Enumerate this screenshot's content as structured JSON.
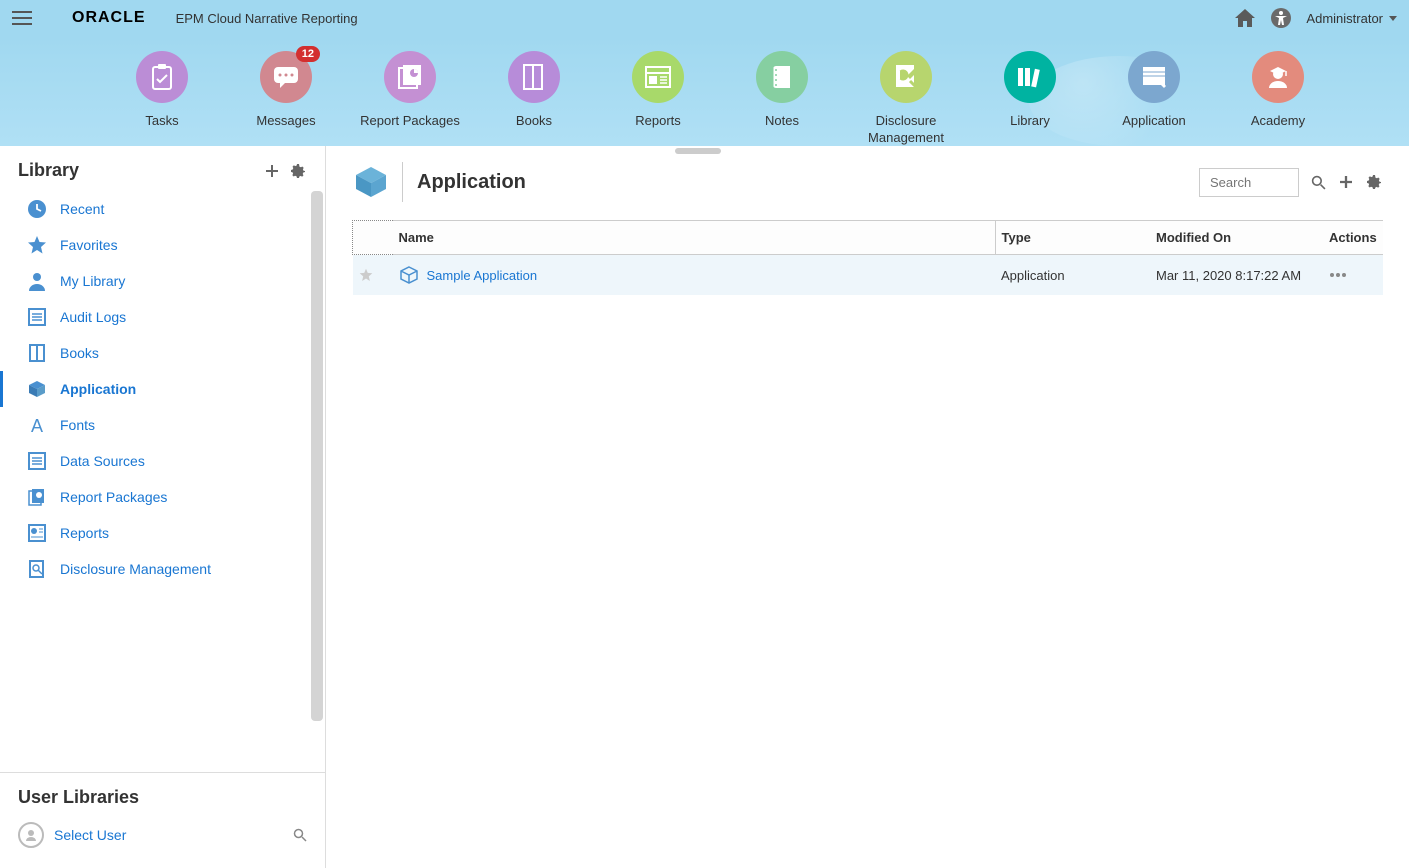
{
  "header": {
    "brand": "ORACLE",
    "product": "EPM Cloud Narrative Reporting",
    "user": "Administrator"
  },
  "nav": [
    {
      "label": "Tasks",
      "color": "#bb8dd6",
      "icon": "clipboard"
    },
    {
      "label": "Messages",
      "color": "#d18890",
      "icon": "chat",
      "badge": "12"
    },
    {
      "label": "Report Packages",
      "color": "#c490d3",
      "icon": "report-pkg"
    },
    {
      "label": "Books",
      "color": "#b78cd9",
      "icon": "book"
    },
    {
      "label": "Reports",
      "color": "#a8d96a",
      "icon": "report"
    },
    {
      "label": "Notes",
      "color": "#86cfa1",
      "icon": "notes"
    },
    {
      "label": "Disclosure\nManagement",
      "color": "#b7d56e",
      "icon": "disclosure"
    },
    {
      "label": "Library",
      "color": "#00b3a1",
      "icon": "library",
      "selected": true
    },
    {
      "label": "Application",
      "color": "#7ca7cf",
      "icon": "application"
    },
    {
      "label": "Academy",
      "color": "#e38b7d",
      "icon": "academy"
    }
  ],
  "sidebar": {
    "title": "Library",
    "items": [
      {
        "label": "Recent",
        "icon": "clock"
      },
      {
        "label": "Favorites",
        "icon": "star"
      },
      {
        "label": "My Library",
        "icon": "person"
      },
      {
        "label": "Audit Logs",
        "icon": "lines"
      },
      {
        "label": "Books",
        "icon": "book-small"
      },
      {
        "label": "Application",
        "icon": "cube",
        "selected": true
      },
      {
        "label": "Fonts",
        "icon": "font"
      },
      {
        "label": "Data Sources",
        "icon": "lines"
      },
      {
        "label": "Report Packages",
        "icon": "report-pkg-small"
      },
      {
        "label": "Reports",
        "icon": "report-small"
      },
      {
        "label": "Disclosure Management",
        "icon": "disclosure-small"
      }
    ],
    "userLibs": {
      "title": "User Libraries",
      "selectUser": "Select User"
    }
  },
  "content": {
    "title": "Application",
    "searchPlaceholder": "Search",
    "columns": {
      "name": "Name",
      "type": "Type",
      "modified": "Modified On",
      "actions": "Actions"
    },
    "rows": [
      {
        "name": "Sample Application",
        "type": "Application",
        "modified": "Mar 11, 2020 8:17:22 AM"
      }
    ]
  }
}
